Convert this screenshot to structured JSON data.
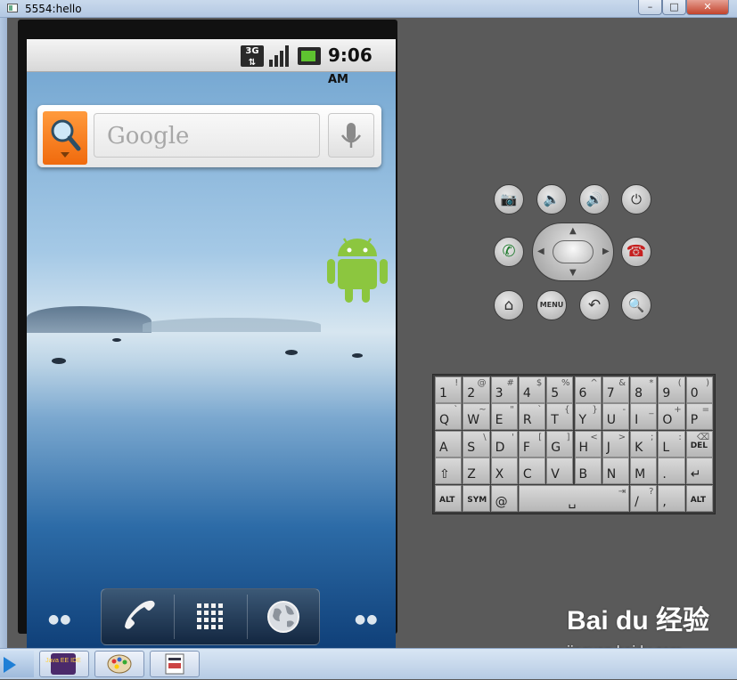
{
  "window": {
    "title": "5554:hello",
    "minimize_label": "–",
    "maximize_label": "□",
    "close_label": "✕"
  },
  "status_bar": {
    "network": "3G",
    "time": "9:06",
    "ampm": "AM"
  },
  "search_widget": {
    "placeholder": "Google"
  },
  "keyboard": {
    "row1": [
      [
        "1",
        "!"
      ],
      [
        "2",
        "@"
      ],
      [
        "3",
        "#"
      ],
      [
        "4",
        "$"
      ],
      [
        "5",
        "%"
      ],
      [
        "6",
        "^"
      ],
      [
        "7",
        "&"
      ],
      [
        "8",
        "*"
      ],
      [
        "9",
        "("
      ],
      [
        "0",
        ")"
      ]
    ],
    "row2": [
      [
        "Q",
        "`"
      ],
      [
        "W",
        "~"
      ],
      [
        "E",
        "\""
      ],
      [
        "R",
        "`"
      ],
      [
        "T",
        "{"
      ],
      [
        "Y",
        "}"
      ],
      [
        "U",
        "-"
      ],
      [
        "I",
        "_"
      ],
      [
        "O",
        "+"
      ],
      [
        "P",
        "="
      ]
    ],
    "row3": [
      [
        "A",
        ""
      ],
      [
        "S",
        "\\"
      ],
      [
        "D",
        "'"
      ],
      [
        "F",
        "["
      ],
      [
        "G",
        "]"
      ],
      [
        "H",
        "<"
      ],
      [
        "J",
        ">"
      ],
      [
        "K",
        ";"
      ],
      [
        "L",
        ":"
      ],
      [
        "DEL",
        "⌫"
      ]
    ],
    "row4": [
      [
        "⇧",
        ""
      ],
      [
        "Z",
        ""
      ],
      [
        "X",
        ""
      ],
      [
        "C",
        ""
      ],
      [
        "V",
        ""
      ],
      [
        "B",
        ""
      ],
      [
        "N",
        ""
      ],
      [
        "M",
        ""
      ],
      [
        ".",
        ""
      ],
      [
        "↵",
        ""
      ]
    ],
    "row5": [
      [
        "ALT",
        ""
      ],
      [
        "SYM",
        ""
      ],
      [
        "@",
        ""
      ],
      [
        "␣",
        "⇥"
      ],
      [
        "/",
        "?"
      ],
      [
        ",",
        ""
      ],
      [
        "ALT",
        ""
      ]
    ]
  },
  "controls": {
    "menu_label": "MENU"
  },
  "watermark": {
    "brand": "Bai du 经验",
    "site": "jingyan.baidu.com"
  },
  "taskbar": {
    "items": [
      "Java EE IDE",
      "Paint",
      "Document"
    ],
    "java_label": "Java EE IDE"
  }
}
